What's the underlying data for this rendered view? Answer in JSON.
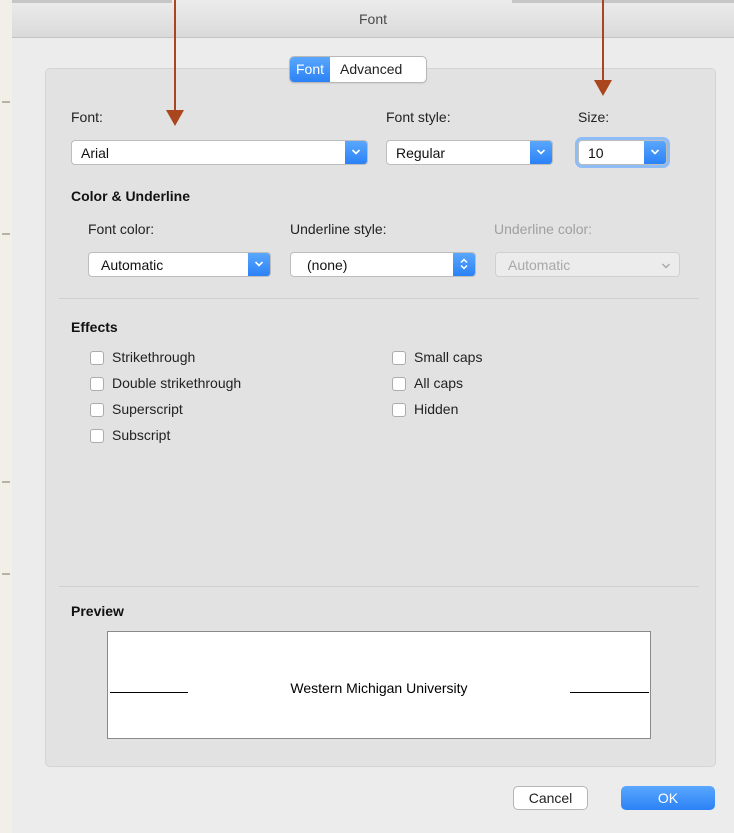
{
  "window": {
    "title": "Font"
  },
  "tabs": [
    {
      "label": "Font"
    },
    {
      "label": "Advanced"
    }
  ],
  "font_section": {
    "font_label": "Font:",
    "font_value": "Arial",
    "style_label": "Font style:",
    "style_value": "Regular",
    "size_label": "Size:",
    "size_value": "10"
  },
  "color_underline": {
    "heading": "Color & Underline",
    "font_color_label": "Font color:",
    "font_color_value": "Automatic",
    "underline_style_label": "Underline style:",
    "underline_style_value": "(none)",
    "underline_color_label": "Underline color:",
    "underline_color_value": "Automatic"
  },
  "effects": {
    "heading": "Effects",
    "left": [
      "Strikethrough",
      "Double strikethrough",
      "Superscript",
      "Subscript"
    ],
    "right": [
      "Small caps",
      "All caps",
      "Hidden"
    ]
  },
  "preview": {
    "heading": "Preview",
    "text": "Western Michigan University"
  },
  "buttons": {
    "cancel": "Cancel",
    "ok": "OK"
  },
  "colors": {
    "accent": "#2b82f6",
    "annotation_arrow": "#a9461e"
  }
}
